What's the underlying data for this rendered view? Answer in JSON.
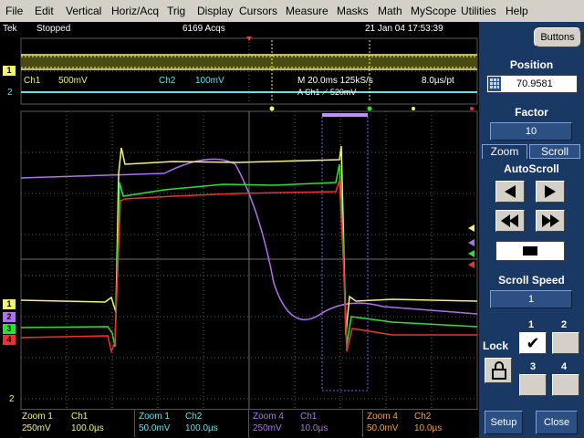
{
  "menubar": {
    "items": [
      "File",
      "Edit",
      "Vertical",
      "Horiz/Acq",
      "Trig",
      "Display",
      "Cursors",
      "Measure",
      "Masks",
      "Math",
      "MyScope",
      "Utilities",
      "Help"
    ]
  },
  "status": {
    "brand": "Tek",
    "state": "Stopped",
    "acquisitions": "6169 Acqs",
    "datetime": "21 Jan 04 17:53:39"
  },
  "overview": {
    "ch1_label": "Ch1",
    "ch1_scale": "500mV",
    "ch2_label": "Ch2",
    "ch2_scale": "100mV",
    "timebase": "M 20.0ms 125kS/s",
    "resolution": "8.0µs/pt",
    "trigger": "A Ch1 ⟋ 520mV",
    "marker_1": "1",
    "marker_2": "2"
  },
  "main": {
    "markers": [
      "1",
      "2",
      "3",
      "4"
    ],
    "ch2_bottom": "2"
  },
  "readouts": [
    {
      "zoom": "Zoom 1",
      "ch": "Ch1",
      "vdiv": "250mV",
      "tdiv": "100.0µs",
      "color": "#f4f470"
    },
    {
      "zoom": "Zoom 1",
      "ch": "Ch2",
      "vdiv": "50.0mV",
      "tdiv": "100.0µs",
      "color": "#60e0e8"
    },
    {
      "zoom": "Zoom 4",
      "ch": "Ch1",
      "vdiv": "250mV",
      "tdiv": "10.0µs",
      "color": "#b070f0"
    },
    {
      "zoom": "Zoom 4",
      "ch": "Ch2",
      "vdiv": "50.0mV",
      "tdiv": "10.0µs",
      "color": "#f0a040"
    }
  ],
  "side": {
    "buttons_label": "Buttons",
    "position_label": "Position",
    "position_value": "70.9581",
    "factor_label": "Factor",
    "factor_value": "10",
    "tab_zoom": "Zoom",
    "tab_scroll": "Scroll",
    "autoscroll_label": "AutoScroll",
    "scroll_speed_label": "Scroll Speed",
    "scroll_speed_value": "1",
    "lock_label": "Lock",
    "lock_numbers": [
      "1",
      "2",
      "3",
      "4"
    ],
    "lock_checked": "✔",
    "setup_label": "Setup",
    "close_label": "Close"
  },
  "colors": {
    "ch1": "#f4f470",
    "ch2": "#60e0e8",
    "ch3": "#b070f0",
    "ch4": "#30e030",
    "ch_red": "#f03030",
    "grid": "#585858",
    "panel": "#1a3864"
  }
}
